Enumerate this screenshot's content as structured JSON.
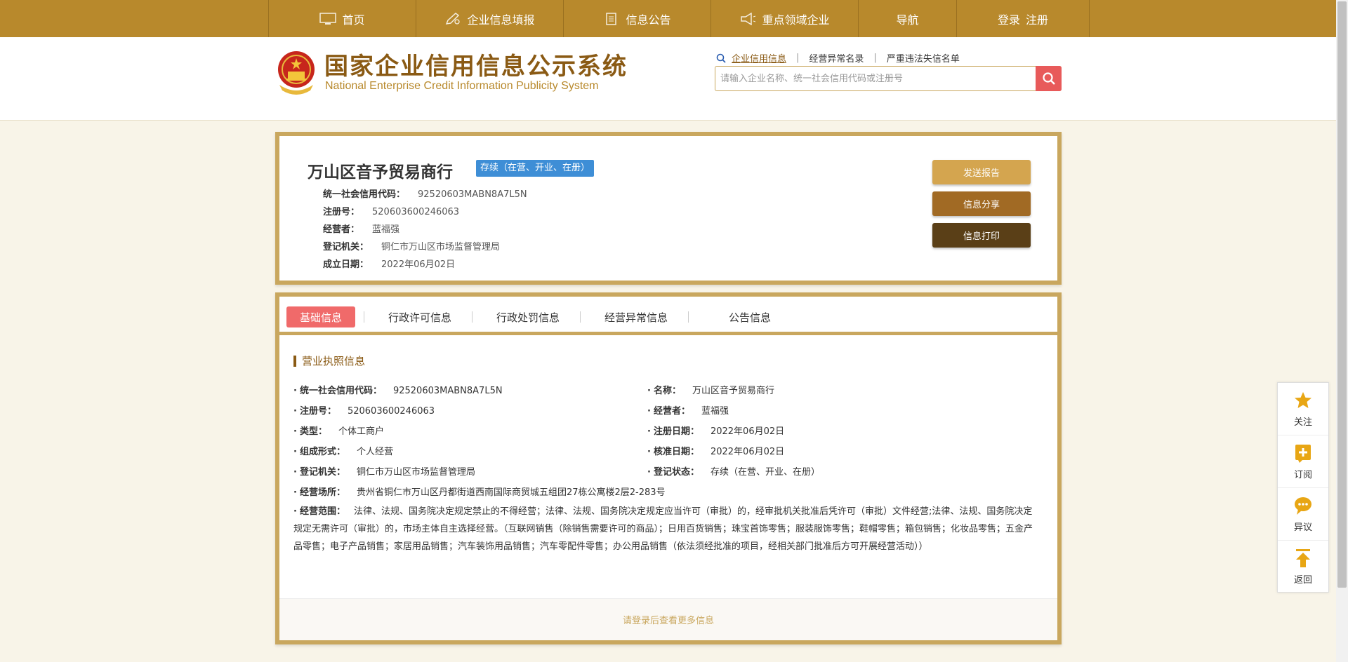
{
  "nav": {
    "items": [
      {
        "label": "首页",
        "icon": "monitor-icon"
      },
      {
        "label": "企业信息填报",
        "icon": "edit-icon"
      },
      {
        "label": "信息公告",
        "icon": "document-icon"
      },
      {
        "label": "重点领域企业",
        "icon": "megaphone-icon"
      },
      {
        "label": "导航"
      }
    ],
    "login": "登录",
    "register": "注册"
  },
  "header": {
    "logo_cn": "国家企业信用信息公示系统",
    "logo_en": "National Enterprise Credit Information Publicity System",
    "search_tabs": [
      "企业信用信息",
      "经营异常名录",
      "严重违法失信名单"
    ],
    "search_placeholder": "请输入企业名称、统一社会信用代码或注册号"
  },
  "company": {
    "name": "万山区音予贸易商行",
    "status": "存续（在营、开业、在册）",
    "info": [
      {
        "key": "统一社会信用代码：",
        "value": "92520603MABN8A7L5N"
      },
      {
        "key": "注册号：",
        "value": "520603600246063"
      },
      {
        "key": "经营者：",
        "value": "蓝福强"
      },
      {
        "key": "登记机关：",
        "value": "铜仁市万山区市场监督管理局"
      },
      {
        "key": "成立日期：",
        "value": "2022年06月02日"
      }
    ],
    "buttons": {
      "send": "发送报告",
      "share": "信息分享",
      "print": "信息打印"
    }
  },
  "tabs": [
    "基础信息",
    "行政许可信息",
    "行政处罚信息",
    "经营异常信息",
    "公告信息"
  ],
  "license": {
    "title": "营业执照信息",
    "left": [
      {
        "key": "统一社会信用代码：",
        "value": "92520603MABN8A7L5N"
      },
      {
        "key": "注册号：",
        "value": "520603600246063"
      },
      {
        "key": "类型：",
        "value": "个体工商户"
      },
      {
        "key": "组成形式：",
        "value": "个人经营"
      },
      {
        "key": "登记机关：",
        "value": "铜仁市万山区市场监督管理局"
      },
      {
        "key": "经营场所：",
        "value": "贵州省铜仁市万山区丹都街道西南国际商贸城五组团27栋公寓楼2层2-283号"
      }
    ],
    "right": [
      {
        "key": "名称：",
        "value": "万山区音予贸易商行"
      },
      {
        "key": "经营者：",
        "value": "蓝福强"
      },
      {
        "key": "注册日期：",
        "value": "2022年06月02日"
      },
      {
        "key": "核准日期：",
        "value": "2022年06月02日"
      },
      {
        "key": "登记状态：",
        "value": "存续（在营、开业、在册）"
      }
    ],
    "scope_key": "经营范围：",
    "scope_value": "法律、法规、国务院决定规定禁止的不得经营；法律、法规、国务院决定规定应当许可（审批）的，经审批机关批准后凭许可（审批）文件经营;法律、法规、国务院决定规定无需许可（审批）的，市场主体自主选择经营。（互联网销售（除销售需要许可的商品）；日用百货销售；珠宝首饰零售；服装服饰零售；鞋帽零售；箱包销售；化妆品零售；五金产品零售；电子产品销售；家居用品销售；汽车装饰用品销售；汽车零配件零售；办公用品销售（依法须经批准的项目，经相关部门批准后方可开展经营活动））",
    "login_more": "请登录后查看更多信息"
  },
  "side": [
    {
      "label": "关注",
      "icon": "star-icon"
    },
    {
      "label": "订阅",
      "icon": "subscribe-icon"
    },
    {
      "label": "异议",
      "icon": "chat-icon"
    },
    {
      "label": "返回",
      "icon": "back-top-icon"
    }
  ],
  "colors": {
    "gold": "#b8892c",
    "brown": "#8a5a14",
    "tab_active": "#f06a6a",
    "status_blue": "#3e8ed6"
  }
}
